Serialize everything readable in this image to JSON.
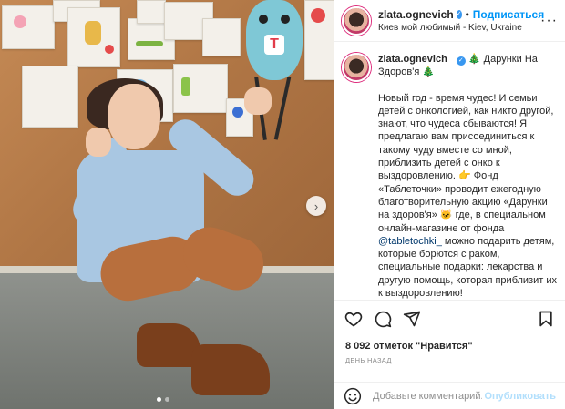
{
  "header": {
    "username": "zlata.ognevich",
    "separator": "•",
    "follow_label": "Подписаться",
    "location": "Киев мой любимый - Kiev, Ukraine",
    "more_label": "···"
  },
  "caption": {
    "username": "zlata.ognevich",
    "title": "🎄 Дарунки На Здоров'я 🎄",
    "text_part1": "Новый год - время чудес! И семьи детей с онкологией, как никто другой, знают, что чудеса сбываются! Я предлагаю вам присоединиться к такому чуду вместе со мной, приблизить детей с онко к выздоровлению. 👉 Фонд «Таблеточки» проводит ежегодную благотворительную акцию «Дарунки на здоров'я» 🐱 где, в специальном онлайн-магазине от фонда ",
    "mention": "@tabletochki_",
    "text_part2": " можно подарить детям, которые борются с раком, специальные подарки: лекарства и другую помощь, которая приблизит их к выздоровлению!"
  },
  "photo": {
    "toy_badge": "T",
    "next_label": "›",
    "slide_count": 2,
    "active_slide": 1
  },
  "actions": {
    "likes": "8 092 отметок \"Нравится\"",
    "time": "ДЕНЬ НАЗАД"
  },
  "comment": {
    "placeholder": "Добавьте комментарий...",
    "post_label": "Опубликовать"
  },
  "colors": {
    "accent": "#0095f6",
    "verified": "#3897f0",
    "post_disabled": "#b2dffc"
  }
}
